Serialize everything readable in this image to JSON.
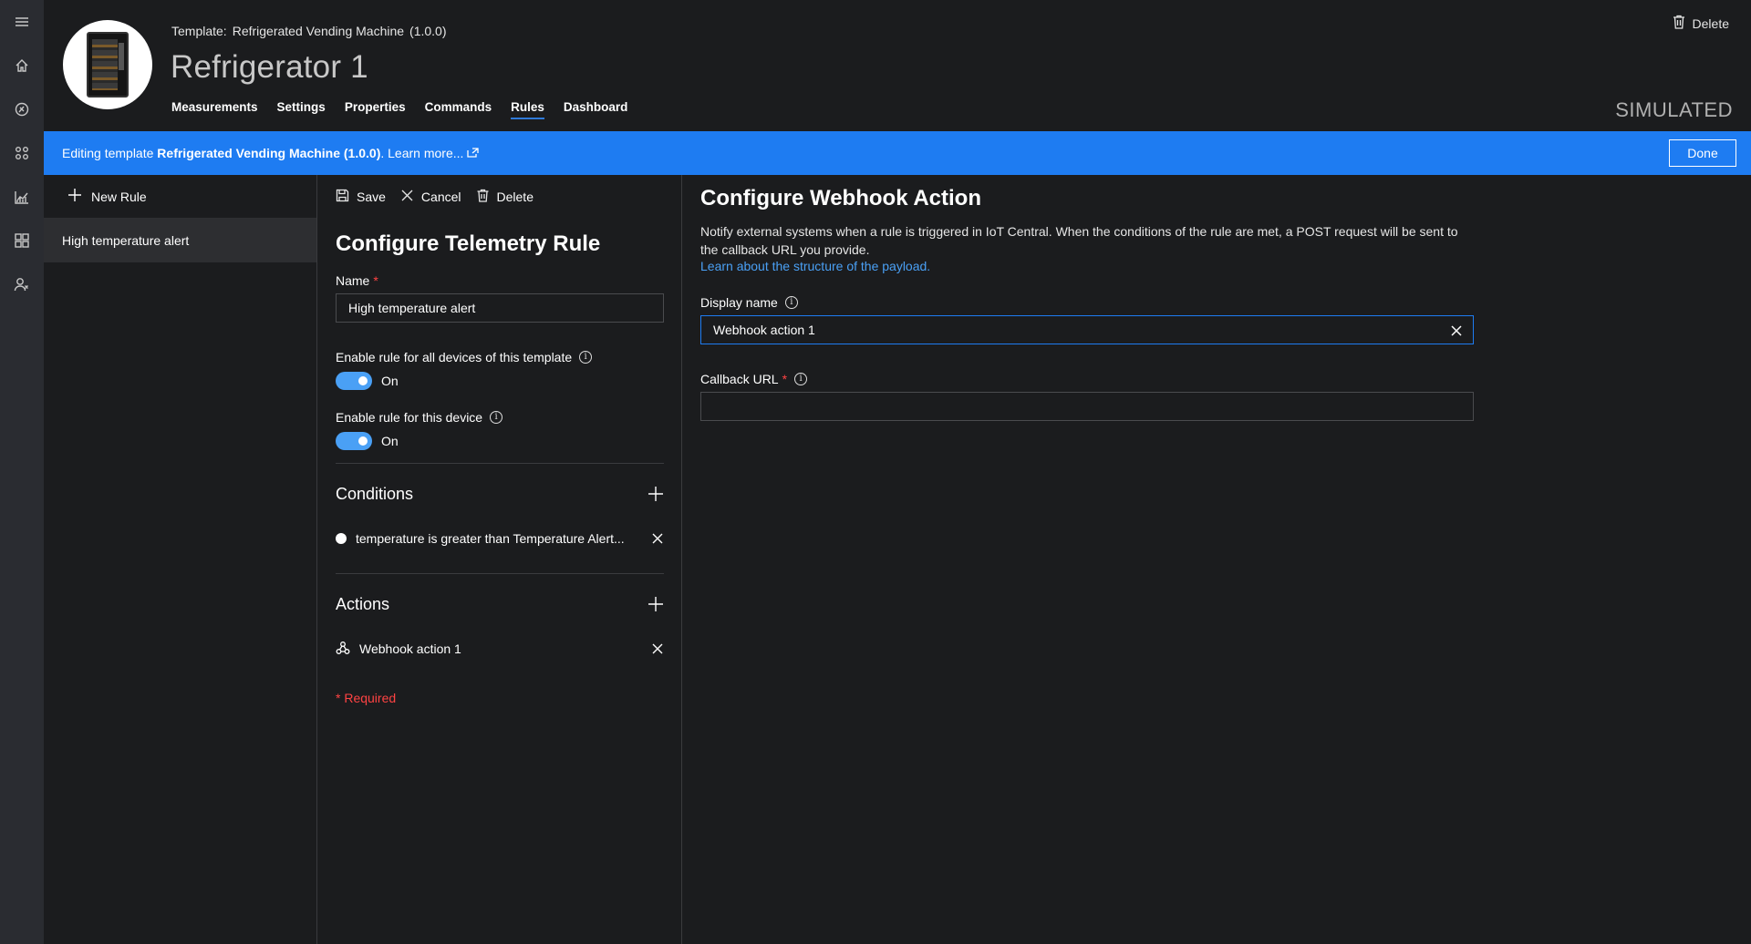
{
  "rail": {
    "items": [
      "menu-icon",
      "home-icon",
      "device-explorer-icon",
      "apps-icon",
      "analytics-icon",
      "dashboard-grid-icon",
      "admin-icon"
    ]
  },
  "header": {
    "template_prefix": "Template:",
    "template_name": "Refrigerated Vending Machine",
    "template_version": "(1.0.0)",
    "device_title": "Refrigerator 1",
    "tabs": [
      "Measurements",
      "Settings",
      "Properties",
      "Commands",
      "Rules",
      "Dashboard"
    ],
    "active_tab": "Rules",
    "delete_label": "Delete",
    "status": "SIMULATED"
  },
  "banner": {
    "prefix": "Editing template",
    "template_bold": "Refrigerated Vending Machine (1.0.0)",
    "suffix": ".",
    "learn_more": "Learn more...",
    "done_label": "Done",
    "color": "#1e7cf2"
  },
  "rules_panel": {
    "new_rule_label": "New Rule",
    "rules": [
      "High temperature alert"
    ]
  },
  "rule_editor": {
    "toolbar": {
      "save": "Save",
      "cancel": "Cancel",
      "delete": "Delete"
    },
    "title": "Configure Telemetry Rule",
    "name_label": "Name",
    "required_mark": "*",
    "name_value": "High temperature alert",
    "enable_all_label": "Enable rule for all devices of this template",
    "enable_all_state": "On",
    "enable_device_label": "Enable rule for this device",
    "enable_device_state": "On",
    "conditions_heading": "Conditions",
    "conditions": [
      "temperature is greater than Temperature Alert..."
    ],
    "actions_heading": "Actions",
    "actions": [
      "Webhook action 1"
    ],
    "required_note": "* Required"
  },
  "action_editor": {
    "title": "Configure Webhook Action",
    "description": "Notify external systems when a rule is triggered in IoT Central. When the conditions of the rule are met, a POST request will be sent to the callback URL you provide.",
    "learn_link": "Learn about the structure of the payload.",
    "display_name_label": "Display name",
    "display_name_value": "Webhook action 1",
    "callback_label": "Callback URL",
    "callback_value": "",
    "accent": "#4aa0f5",
    "required_color": "#ff4343"
  }
}
